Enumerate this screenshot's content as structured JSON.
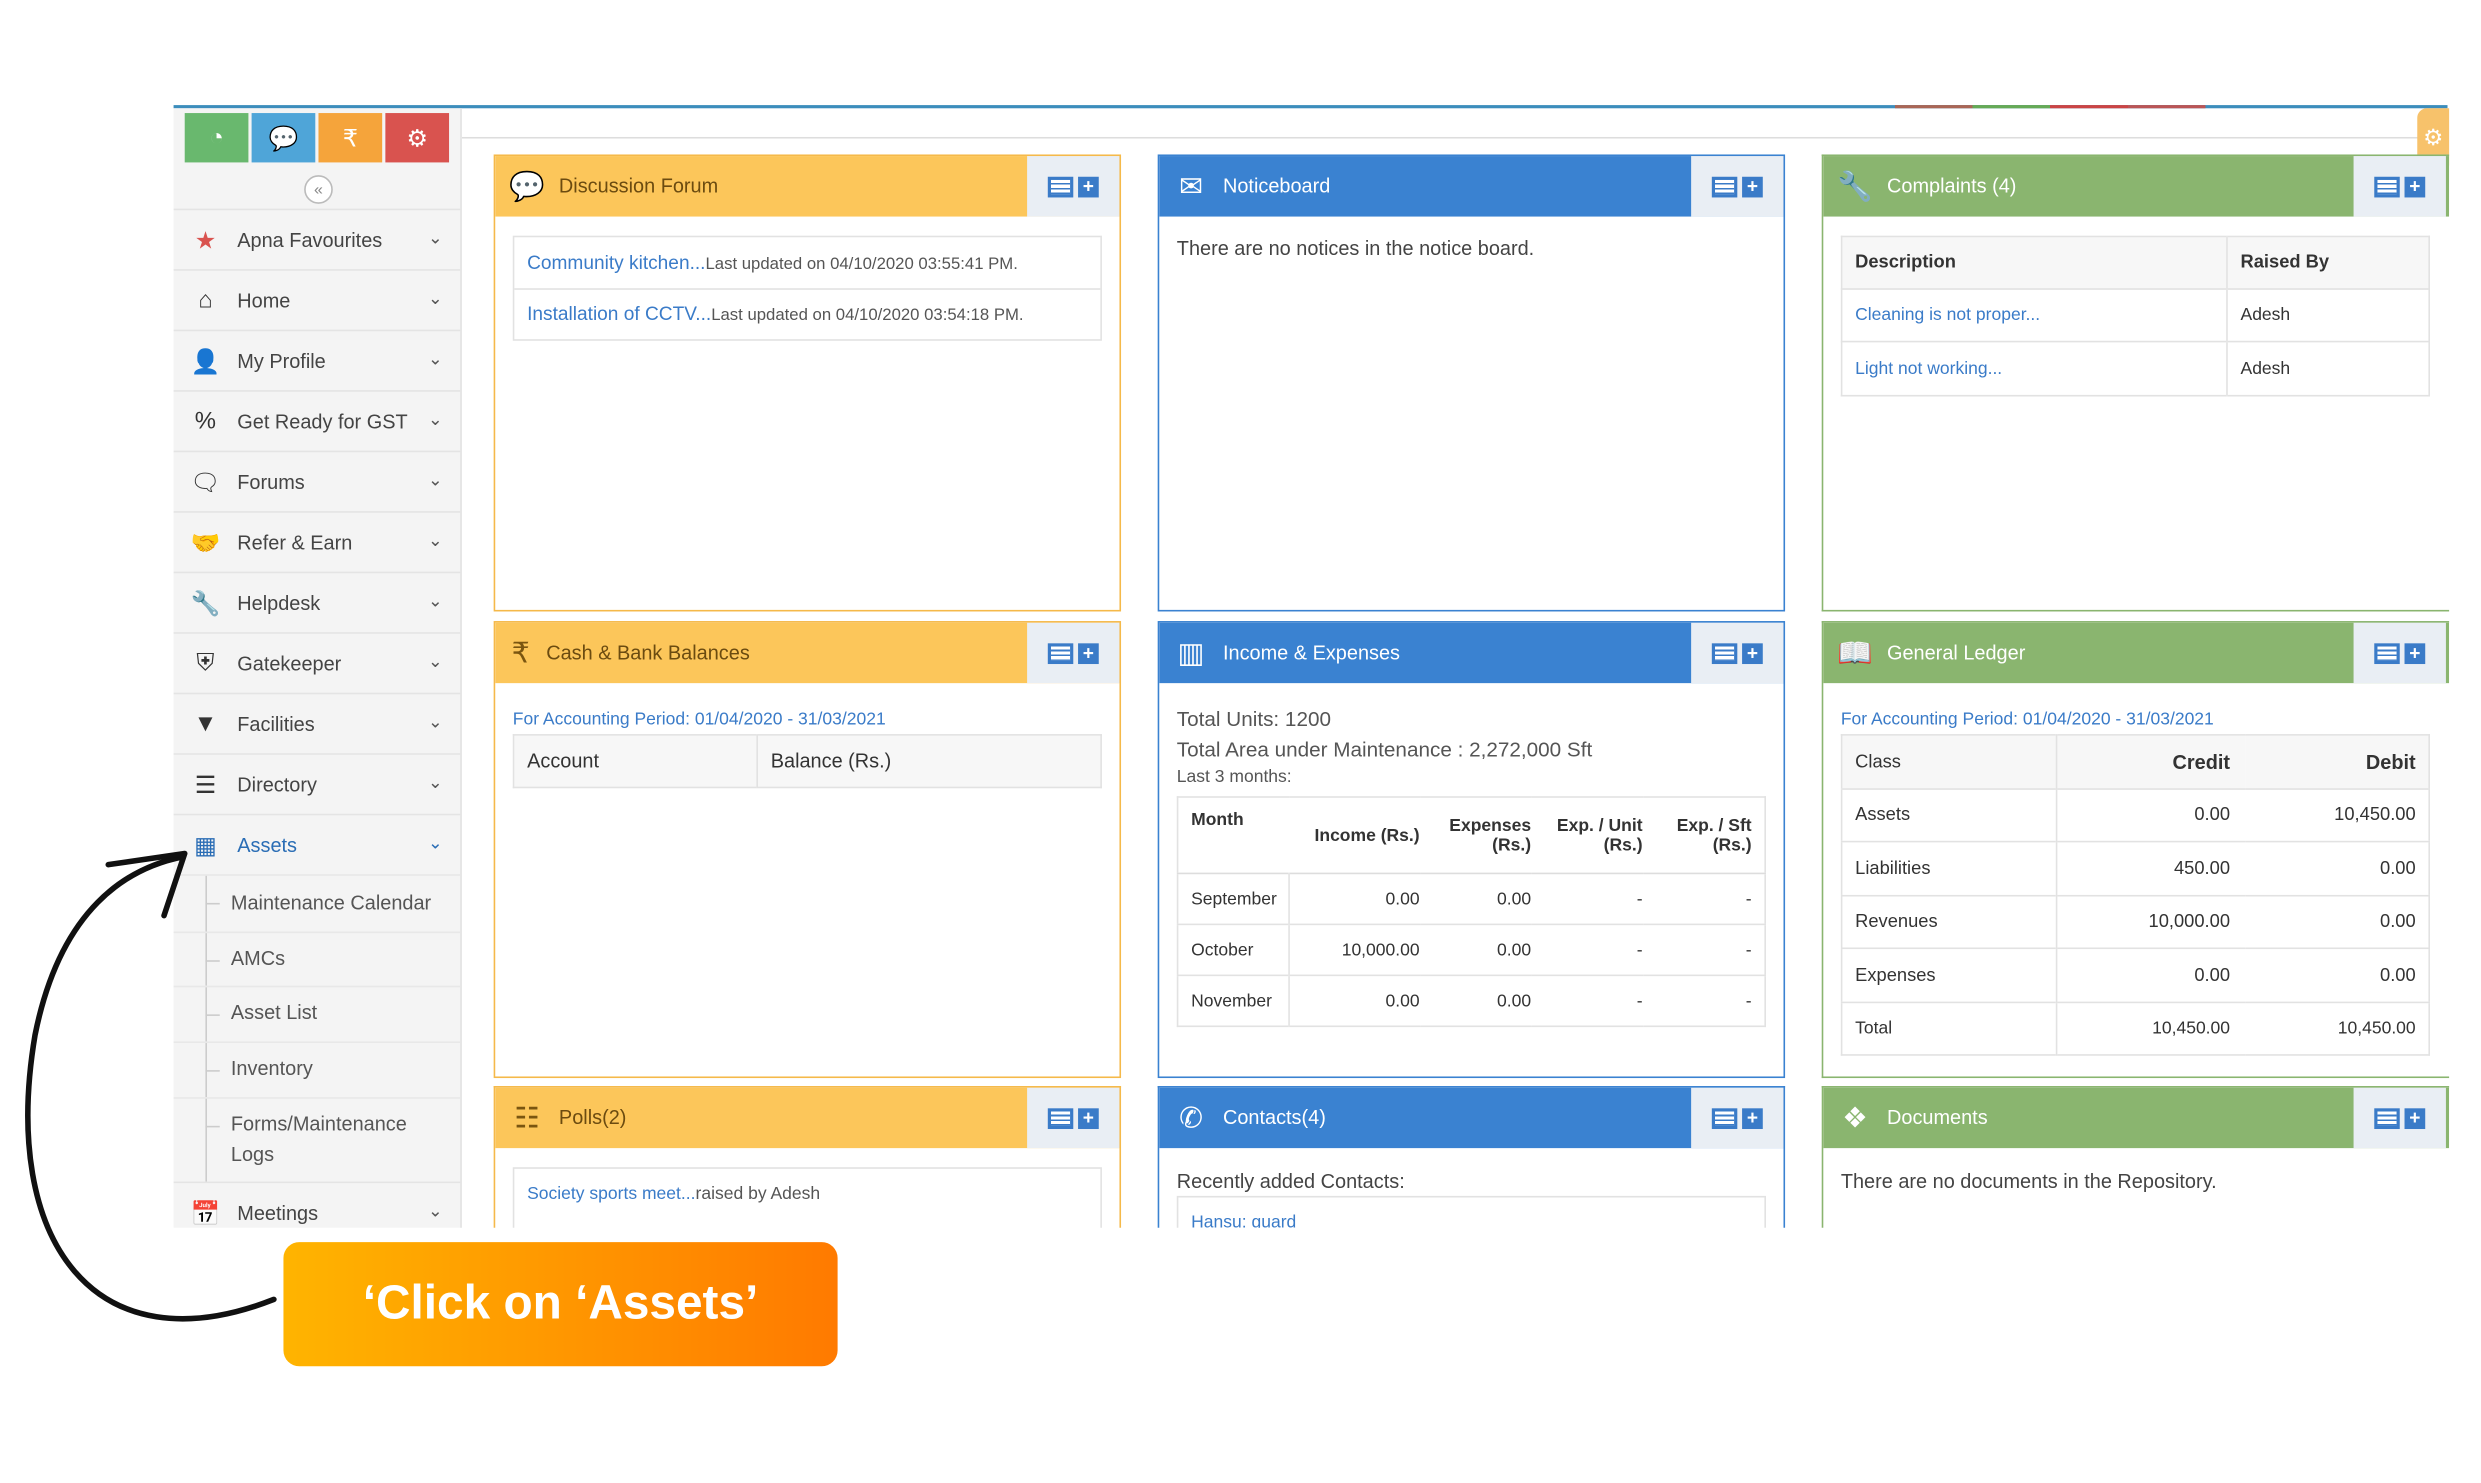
{
  "quick_buttons": [
    {
      "icon": "dashboard-icon",
      "color": "#69b86e"
    },
    {
      "icon": "chat-icon",
      "color": "#4fa5d8"
    },
    {
      "icon": "rupee-icon",
      "color": "#f5a43b"
    },
    {
      "icon": "settings-icon",
      "color": "#d9534f"
    }
  ],
  "sidebar": {
    "items": [
      {
        "label": "Apna Favourites",
        "icon": "star-icon"
      },
      {
        "label": "Home",
        "icon": "home-icon"
      },
      {
        "label": "My Profile",
        "icon": "user-icon"
      },
      {
        "label": "Get Ready for GST",
        "icon": "percent-icon"
      },
      {
        "label": "Forums",
        "icon": "comments-icon"
      },
      {
        "label": "Refer & Earn",
        "icon": "handshake-icon"
      },
      {
        "label": "Helpdesk",
        "icon": "wrench-icon"
      },
      {
        "label": "Gatekeeper",
        "icon": "shield-icon"
      },
      {
        "label": "Facilities",
        "icon": "filter-icon"
      },
      {
        "label": "Directory",
        "icon": "list-icon"
      },
      {
        "label": "Assets",
        "icon": "building-icon"
      }
    ],
    "assets_sub": [
      "Maintenance Calendar",
      "AMCs",
      "Asset List",
      "Inventory",
      "Forms/Maintenance Logs"
    ],
    "after": {
      "label": "Meetings",
      "icon": "calendar-icon"
    }
  },
  "discussion": {
    "title": "Discussion Forum",
    "rows": [
      {
        "link": "Community kitchen...",
        "meta": "Last updated on 04/10/2020 03:55:41 PM."
      },
      {
        "link": "Installation of CCTV...",
        "meta": "Last updated on 04/10/2020 03:54:18 PM."
      }
    ]
  },
  "noticeboard": {
    "title": "Noticeboard",
    "empty": "There are no notices in the notice board."
  },
  "complaints": {
    "title": "Complaints (4)",
    "headers": [
      "Description",
      "Raised By"
    ],
    "rows": [
      [
        "Cleaning is not proper...",
        "Adesh"
      ],
      [
        "Light not working...",
        "Adesh"
      ]
    ]
  },
  "cash": {
    "title": "Cash & Bank Balances",
    "period": "For Accounting Period: 01/04/2020 - 31/03/2021",
    "headers": [
      "Account",
      "Balance (Rs.)"
    ]
  },
  "income": {
    "title": "Income & Expenses",
    "units": "Total Units: 1200",
    "area": "Total Area under Maintenance : 2,272,000 Sft",
    "last": "Last 3 months:",
    "headers": [
      "Month",
      "Income (Rs.)",
      "Expenses (Rs.)",
      "Exp. / Unit (Rs.)",
      "Exp. / Sft (Rs.)"
    ],
    "rows": [
      [
        "September",
        "0.00",
        "0.00",
        "-",
        "-"
      ],
      [
        "October",
        "10,000.00",
        "0.00",
        "-",
        "-"
      ],
      [
        "November",
        "0.00",
        "0.00",
        "-",
        "-"
      ]
    ]
  },
  "ledger": {
    "title": "General Ledger",
    "period": "For Accounting Period: 01/04/2020 - 31/03/2021",
    "headers": [
      "Class",
      "Credit",
      "Debit"
    ],
    "rows": [
      [
        "Assets",
        "0.00",
        "10,450.00"
      ],
      [
        "Liabilities",
        "450.00",
        "0.00"
      ],
      [
        "Revenues",
        "10,000.00",
        "0.00"
      ],
      [
        "Expenses",
        "0.00",
        "0.00"
      ],
      [
        "Total",
        "10,450.00",
        "10,450.00"
      ]
    ]
  },
  "polls": {
    "title": "Polls(2)",
    "row_link": "Society sports meet...",
    "row_meta": "raised by Adesh"
  },
  "contacts": {
    "title": "Contacts(4)",
    "recent": "Recently added Contacts:",
    "first": "Hansu: guard"
  },
  "documents": {
    "title": "Documents",
    "empty": "There are no documents in the Repository."
  },
  "callout": {
    "text": "‘Click on ‘Assets’"
  }
}
